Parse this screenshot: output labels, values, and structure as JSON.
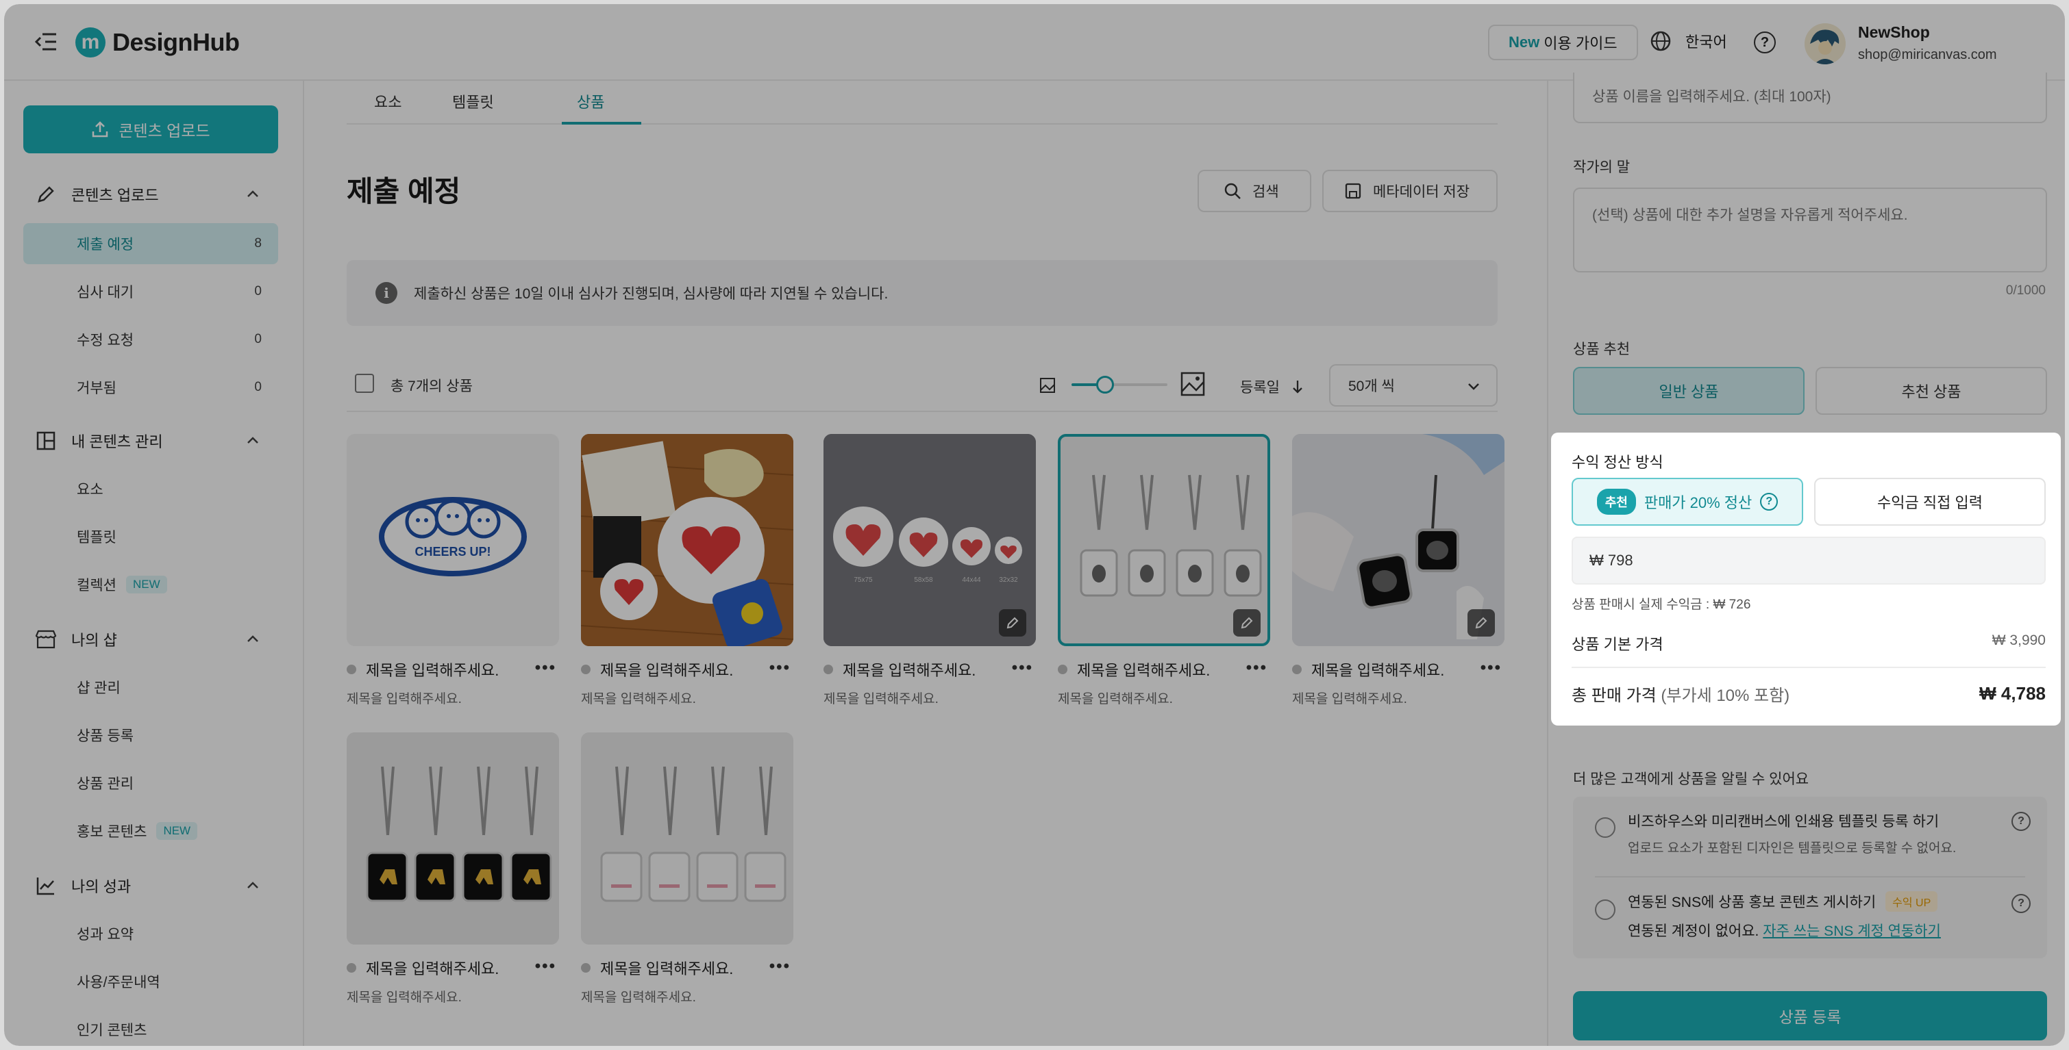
{
  "header": {
    "logo_mark": "m",
    "logo_text": "DesignHub",
    "guide_new": "New",
    "guide_label": "이용 가이드",
    "language": "한국어",
    "help": "?",
    "user_name": "NewShop",
    "user_email": "shop@miricanvas.com"
  },
  "sidebar": {
    "upload_button": "콘텐츠 업로드",
    "sections": [
      {
        "label": "콘텐츠 업로드",
        "icon": "pencil-icon"
      },
      {
        "label": "내 콘텐츠 관리",
        "icon": "grid-icon"
      },
      {
        "label": "나의 샵",
        "icon": "store-icon"
      },
      {
        "label": "나의 성과",
        "icon": "chart-line-icon"
      }
    ],
    "items": [
      {
        "label": "제출 예정",
        "count": "8"
      },
      {
        "label": "심사 대기",
        "count": "0"
      },
      {
        "label": "수정 요청",
        "count": "0"
      },
      {
        "label": "거부됨",
        "count": "0"
      },
      {
        "label": "요소"
      },
      {
        "label": "템플릿"
      },
      {
        "label": "컬렉션",
        "badge": "NEW"
      },
      {
        "label": "샵 관리"
      },
      {
        "label": "상품 등록"
      },
      {
        "label": "상품 관리"
      },
      {
        "label": "홍보 콘텐츠",
        "badge": "NEW"
      },
      {
        "label": "성과 요약"
      },
      {
        "label": "사용/주문내역"
      },
      {
        "label": "인기 콘텐츠"
      }
    ]
  },
  "main": {
    "tabs": [
      "요소",
      "템플릿",
      "상품"
    ],
    "active_tab": "상품",
    "title": "제출 예정",
    "search_button": "검색",
    "save_meta_button": "메타데이터 저장",
    "notice": "제출하신 상품은 10일 이내 심사가 진행되며, 심사량에 따라 지연될 수 있습니다.",
    "total_label": "총 7개의 상품",
    "thumb_size_level": 0.35,
    "sort_label": "등록일",
    "per_page": "50개 씩",
    "cards": [
      {
        "title": "제목을 입력해주세요.",
        "subtitle": "제목을 입력해주세요."
      },
      {
        "title": "제목을 입력해주세요.",
        "subtitle": "제목을 입력해주세요."
      },
      {
        "title": "제목을 입력해주세요.",
        "subtitle": "제목을 입력해주세요."
      },
      {
        "title": "제목을 입력해주세요.",
        "subtitle": "제목을 입력해주세요."
      },
      {
        "title": "제목을 입력해주세요.",
        "subtitle": "제목을 입력해주세요."
      },
      {
        "title": "제목을 입력해주세요.",
        "subtitle": "제목을 입력해주세요."
      },
      {
        "title": "제목을 입력해주세요.",
        "subtitle": "제목을 입력해주세요."
      }
    ],
    "card1_text": "CHEERS UP!",
    "card3_sizes": [
      "75x75",
      "58x58",
      "44x44",
      "32x32"
    ]
  },
  "right_panel": {
    "name_placeholder": "상품 이름을 입력해주세요. (최대 100자)",
    "artist_note_label": "작가의 말",
    "artist_note_placeholder": "(선택) 상품에 대한 추가 설명을 자유롭게 적어주세요.",
    "artist_note_count": "0/1000",
    "recommend_label": "상품 추천",
    "recommend_options": [
      "일반 상품",
      "추천 상품"
    ],
    "promo_title": "더 많은 고객에게 상품을 알릴 수 있어요",
    "promo_options": [
      {
        "title": "비즈하우스와 미리캔버스에 인쇄용 템플릿 등록 하기",
        "desc": "업로드 요소가 포함된 디자인은 템플릿으로 등록할 수 없어요."
      },
      {
        "title": "연동된 SNS에 상품 홍보 콘텐츠 게시하기",
        "badge": "수익 UP",
        "desc": "연동된 계정이 없어요.",
        "link": "자주 쓰는 SNS 계정 연동하기"
      }
    ],
    "submit_button": "상품 등록"
  },
  "popup": {
    "title": "수익 정산 방식",
    "rec_chip": "추천",
    "option_recommended": "판매가 20% 정산",
    "option_manual": "수익금 직접 입력",
    "amount": "₩ 798",
    "real_revenue": "상품 판매시 실제 수익금 : ₩ 726",
    "base_price_label": "상품 기본 가격",
    "base_price": "₩ 3,990",
    "total_price_label": "총 판매 가격",
    "total_price_note": "(부가세 10% 포함)",
    "total_price": "₩ 4,788"
  },
  "colors": {
    "accent": "#1cb0b8",
    "accent_dark": "#118a91",
    "accent_light": "#d4f1f3"
  }
}
